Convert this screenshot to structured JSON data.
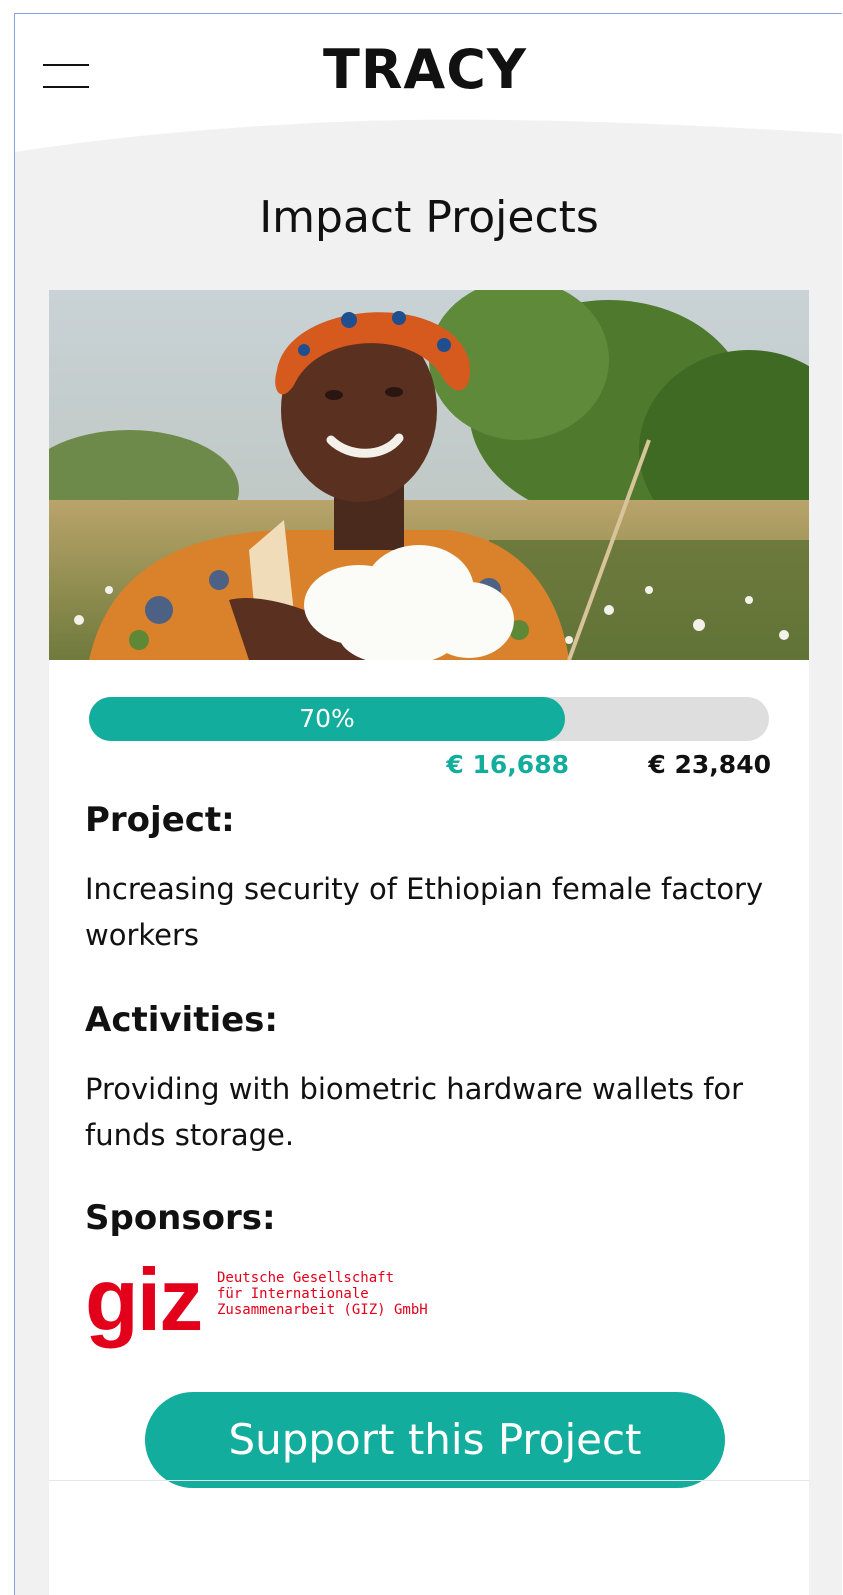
{
  "header": {
    "brand": "TRACY",
    "menu_icon": "hamburger-menu-icon"
  },
  "page": {
    "title": "Impact Projects"
  },
  "project_card": {
    "image_description_icon": "photo-woman-holding-cotton",
    "progress": {
      "percent_label": "70%",
      "fraction": 0.7,
      "raised": "€ 16,688",
      "goal": "€ 23,840"
    },
    "project_label": "Project:",
    "project_text": "Increasing security of Ethiopian female factory workers",
    "activities_label": "Activities:",
    "activities_text": "Providing with biometric hardware wallets for funds storage.",
    "sponsors_label": "Sponsors:",
    "sponsor": {
      "logo_mark": "giz",
      "logo_line1": "Deutsche Gesellschaft",
      "logo_line2": "für Internationale",
      "logo_line3": "Zusammenarbeit (GIZ) GmbH"
    },
    "support_button": "Support this Project"
  },
  "colors": {
    "accent": "#12ad9d",
    "sponsor_red": "#e3001b",
    "track": "#dedede"
  }
}
